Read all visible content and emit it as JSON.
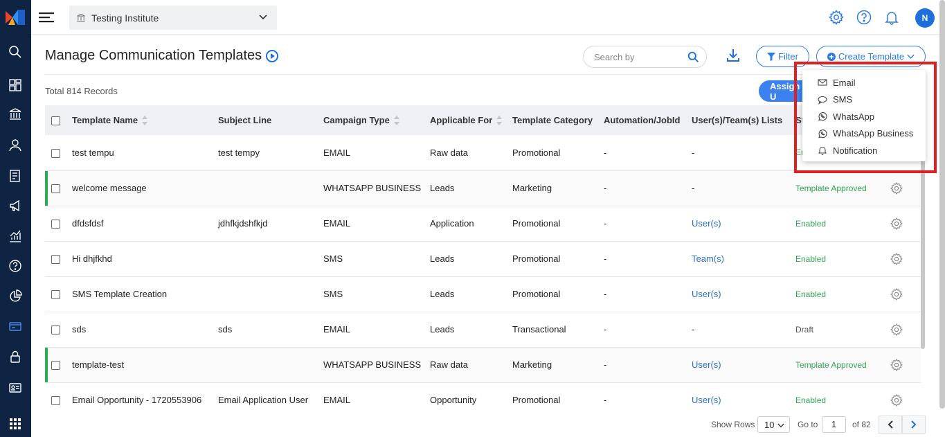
{
  "topbar": {
    "institute": "Testing Institute",
    "avatar_initial": "N"
  },
  "page": {
    "title": "Manage Communication Templates",
    "total_prefix": "Total",
    "total_count": "814",
    "total_suffix": "Records",
    "assign_label": "Assign U"
  },
  "search": {
    "placeholder": "Search by"
  },
  "buttons": {
    "filter": "Filter",
    "create": "Create Template"
  },
  "dropdown": {
    "items": [
      "Email",
      "SMS",
      "WhatsApp",
      "WhatsApp Business",
      "Notification"
    ]
  },
  "table": {
    "headers": [
      "Template Name",
      "Subject Line",
      "Campaign Type",
      "Applicable For",
      "Template Category",
      "Automation/JobId",
      "User(s)/Team(s) Lists",
      "St"
    ],
    "rows": [
      {
        "name": "test tempu",
        "subject": "test tempy",
        "campaign": "EMAIL",
        "applicable": "Raw data",
        "category": "Promotional",
        "automation": "-",
        "lists": "-",
        "status": "En",
        "status_color": "#34a353"
      },
      {
        "name": "welcome message",
        "subject": "",
        "campaign": "WHATSAPP BUSINESS",
        "applicable": "Leads",
        "category": "Marketing",
        "automation": "-",
        "lists": "-",
        "status": "Template Approved",
        "status_color": "#34a353"
      },
      {
        "name": "dfdsfdsf",
        "subject": "jdhfkjdshfkjd",
        "campaign": "EMAIL",
        "applicable": "Application",
        "category": "Promotional",
        "automation": "-",
        "lists": "User(s)",
        "status": "Enabled",
        "status_color": "#34a353"
      },
      {
        "name": "Hi dhjfkhd",
        "subject": "",
        "campaign": "SMS",
        "applicable": "Leads",
        "category": "Promotional",
        "automation": "-",
        "lists": "Team(s)",
        "status": "Enabled",
        "status_color": "#34a353"
      },
      {
        "name": "SMS Template Creation",
        "subject": "",
        "campaign": "SMS",
        "applicable": "Leads",
        "category": "Promotional",
        "automation": "-",
        "lists": "User(s)",
        "status": "Enabled",
        "status_color": "#34a353"
      },
      {
        "name": "sds",
        "subject": "sds",
        "campaign": "EMAIL",
        "applicable": "Leads",
        "category": "Transactional",
        "automation": "-",
        "lists": "-",
        "status": "Draft",
        "status_color": "#555555"
      },
      {
        "name": "template-test",
        "subject": "",
        "campaign": "WHATSAPP BUSINESS",
        "applicable": "Raw data",
        "category": "Marketing",
        "automation": "-",
        "lists": "User(s)",
        "status": "Template Approved",
        "status_color": "#34a353"
      },
      {
        "name": "Email Opportunity - 1720553906",
        "subject": "Email Application User",
        "campaign": "EMAIL",
        "applicable": "Opportunity",
        "category": "Promotional",
        "automation": "-",
        "lists": "User(s)",
        "status": "Enabled",
        "status_color": "#34a353"
      }
    ]
  },
  "pagination": {
    "show_rows_label": "Show Rows",
    "rows_value": "10",
    "goto_label": "Go to",
    "page_value": "1",
    "of_label": "of 82"
  },
  "colors": {
    "accent": "#2d7be5",
    "sidebar": "#0f2343",
    "highlight": "#e02020"
  }
}
